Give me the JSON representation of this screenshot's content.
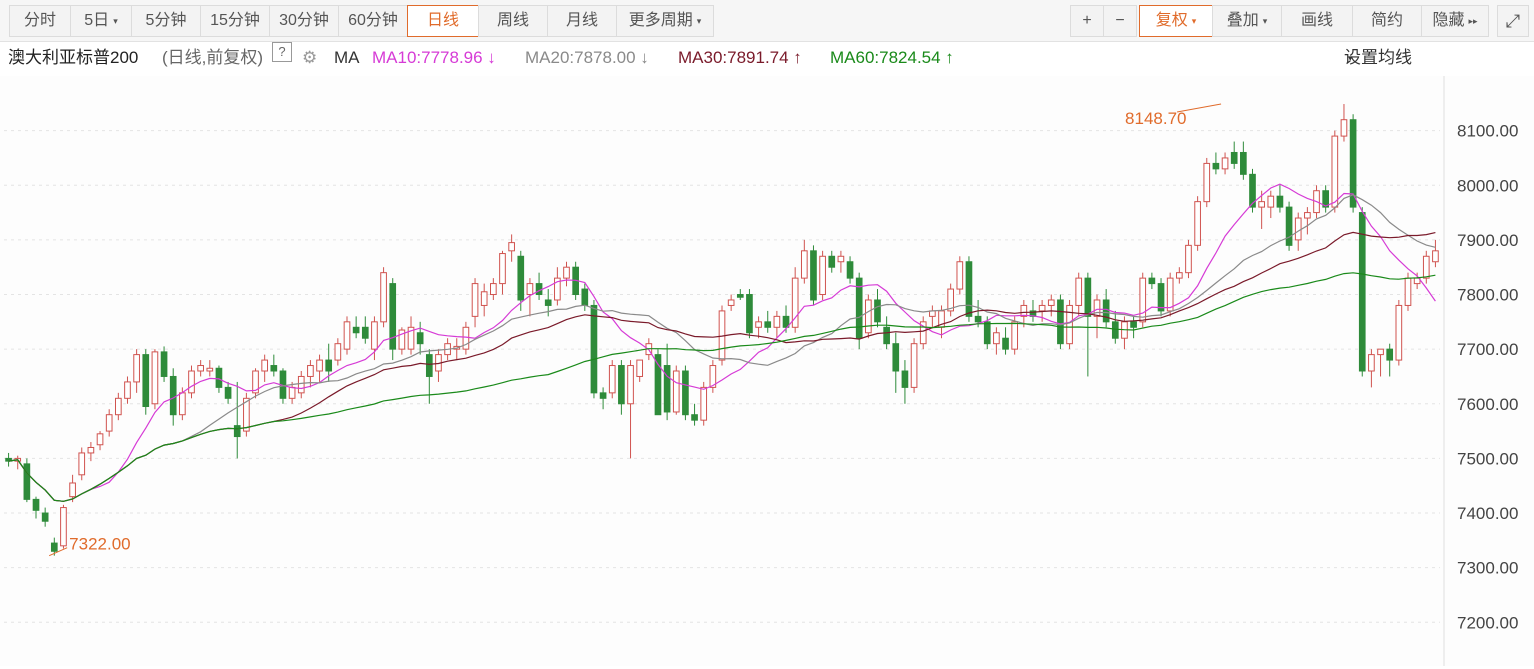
{
  "toolbar": {
    "left_buttons": [
      {
        "label": "分时",
        "dropdown": false,
        "active": false
      },
      {
        "label": "5日",
        "dropdown": true,
        "active": false
      },
      {
        "label": "5分钟",
        "dropdown": false,
        "active": false
      },
      {
        "label": "15分钟",
        "dropdown": false,
        "active": false
      },
      {
        "label": "30分钟",
        "dropdown": false,
        "active": false
      },
      {
        "label": "60分钟",
        "dropdown": false,
        "active": false
      },
      {
        "label": "日线",
        "dropdown": false,
        "active": true
      },
      {
        "label": "周线",
        "dropdown": false,
        "active": false
      },
      {
        "label": "月线",
        "dropdown": false,
        "active": false
      },
      {
        "label": "更多周期",
        "dropdown": true,
        "active": false
      }
    ],
    "zoom_in": "+",
    "zoom_out": "−",
    "right_buttons": [
      {
        "label": "复权",
        "dropdown": true,
        "accent": true
      },
      {
        "label": "叠加",
        "dropdown": true,
        "accent": false
      },
      {
        "label": "画线",
        "dropdown": false,
        "accent": false
      },
      {
        "label": "简约",
        "dropdown": false,
        "accent": false
      },
      {
        "label": "隐藏",
        "dropdown": false,
        "accent": false,
        "suffix": "▸▸"
      }
    ],
    "fullscreen_icon": "expand-icon"
  },
  "legend": {
    "title": "澳大利亚标普200",
    "subtitle": "(日线,前复权)",
    "help": "?",
    "ma_label": "MA",
    "ma": [
      {
        "text": "MA10:7778.96",
        "arrow": "↓",
        "color": "#d63bd6"
      },
      {
        "text": "MA20:7878.00",
        "arrow": "↓",
        "color": "#8a8a8a"
      },
      {
        "text": "MA30:7891.74",
        "arrow": "↑",
        "color": "#7a1a2a"
      },
      {
        "text": "MA60:7824.54",
        "arrow": "↑",
        "color": "#1a8a1a"
      }
    ],
    "settings": "设置均线"
  },
  "colors": {
    "up": "#d0534f",
    "down": "#2e8b3a",
    "annotation": "#e06b2b",
    "grid": "#e4e4e4",
    "axis_text": "#444"
  },
  "chart_data": {
    "type": "candlestick",
    "y_tick_labels": [
      "8100.00",
      "8000.00",
      "7900.00",
      "7800.00",
      "7700.00",
      "7600.00",
      "7500.00",
      "7400.00",
      "7300.00",
      "7200.00"
    ],
    "y_ticks": [
      8100,
      8000,
      7900,
      7800,
      7700,
      7600,
      7500,
      7400,
      7300,
      7200
    ],
    "ylim": [
      7120,
      8200
    ],
    "high_annotation": {
      "label": "8148.70",
      "value": 8148.7,
      "index": 133
    },
    "low_annotation": {
      "label": "7322.00",
      "value": 7322,
      "index": 4
    },
    "candles": [
      [
        7500,
        7510,
        7485,
        7495
      ],
      [
        7495,
        7505,
        7480,
        7500
      ],
      [
        7490,
        7500,
        7420,
        7425
      ],
      [
        7425,
        7430,
        7390,
        7405
      ],
      [
        7400,
        7410,
        7375,
        7385
      ],
      [
        7345,
        7355,
        7322,
        7330
      ],
      [
        7340,
        7415,
        7335,
        7410
      ],
      [
        7430,
        7470,
        7420,
        7455
      ],
      [
        7470,
        7520,
        7460,
        7510
      ],
      [
        7510,
        7530,
        7495,
        7520
      ],
      [
        7525,
        7550,
        7515,
        7545
      ],
      [
        7550,
        7590,
        7540,
        7580
      ],
      [
        7580,
        7620,
        7570,
        7610
      ],
      [
        7610,
        7650,
        7600,
        7640
      ],
      [
        7640,
        7700,
        7620,
        7690
      ],
      [
        7690,
        7700,
        7580,
        7595
      ],
      [
        7600,
        7700,
        7590,
        7695
      ],
      [
        7695,
        7705,
        7640,
        7650
      ],
      [
        7650,
        7665,
        7560,
        7580
      ],
      [
        7580,
        7630,
        7570,
        7620
      ],
      [
        7620,
        7670,
        7610,
        7660
      ],
      [
        7660,
        7680,
        7650,
        7670
      ],
      [
        7660,
        7680,
        7650,
        7665
      ],
      [
        7665,
        7670,
        7620,
        7630
      ],
      [
        7630,
        7640,
        7600,
        7610
      ],
      [
        7560,
        7640,
        7500,
        7540
      ],
      [
        7550,
        7620,
        7540,
        7610
      ],
      [
        7620,
        7665,
        7610,
        7660
      ],
      [
        7660,
        7690,
        7640,
        7680
      ],
      [
        7670,
        7690,
        7650,
        7660
      ],
      [
        7660,
        7665,
        7600,
        7610
      ],
      [
        7610,
        7640,
        7600,
        7630
      ],
      [
        7620,
        7660,
        7610,
        7650
      ],
      [
        7650,
        7680,
        7630,
        7670
      ],
      [
        7660,
        7690,
        7640,
        7680
      ],
      [
        7680,
        7710,
        7640,
        7660
      ],
      [
        7680,
        7720,
        7670,
        7710
      ],
      [
        7700,
        7760,
        7690,
        7750
      ],
      [
        7740,
        7760,
        7720,
        7730
      ],
      [
        7740,
        7760,
        7710,
        7720
      ],
      [
        7700,
        7760,
        7680,
        7750
      ],
      [
        7750,
        7850,
        7740,
        7840
      ],
      [
        7820,
        7830,
        7680,
        7700
      ],
      [
        7700,
        7740,
        7690,
        7735
      ],
      [
        7700,
        7760,
        7690,
        7740
      ],
      [
        7730,
        7750,
        7690,
        7710
      ],
      [
        7690,
        7700,
        7600,
        7650
      ],
      [
        7660,
        7700,
        7640,
        7690
      ],
      [
        7690,
        7720,
        7680,
        7710
      ],
      [
        7700,
        7720,
        7680,
        7705
      ],
      [
        7700,
        7750,
        7690,
        7740
      ],
      [
        7760,
        7830,
        7740,
        7820
      ],
      [
        7780,
        7820,
        7760,
        7805
      ],
      [
        7800,
        7830,
        7790,
        7820
      ],
      [
        7820,
        7880,
        7800,
        7875
      ],
      [
        7880,
        7910,
        7860,
        7895
      ],
      [
        7870,
        7880,
        7770,
        7790
      ],
      [
        7800,
        7830,
        7760,
        7820
      ],
      [
        7820,
        7840,
        7790,
        7800
      ],
      [
        7790,
        7810,
        7760,
        7780
      ],
      [
        7790,
        7850,
        7780,
        7830
      ],
      [
        7830,
        7860,
        7815,
        7850
      ],
      [
        7850,
        7860,
        7790,
        7800
      ],
      [
        7810,
        7820,
        7770,
        7780
      ],
      [
        7780,
        7790,
        7610,
        7620
      ],
      [
        7620,
        7630,
        7590,
        7610
      ],
      [
        7620,
        7680,
        7610,
        7670
      ],
      [
        7670,
        7680,
        7580,
        7600
      ],
      [
        7600,
        7680,
        7500,
        7670
      ],
      [
        7650,
        7680,
        7640,
        7680
      ],
      [
        7690,
        7720,
        7680,
        7710
      ],
      [
        7690,
        7700,
        7640,
        7580
      ],
      [
        7670,
        7710,
        7570,
        7585
      ],
      [
        7585,
        7670,
        7580,
        7660
      ],
      [
        7660,
        7670,
        7570,
        7580
      ],
      [
        7580,
        7600,
        7560,
        7570
      ],
      [
        7570,
        7640,
        7560,
        7630
      ],
      [
        7630,
        7680,
        7620,
        7670
      ],
      [
        7680,
        7780,
        7670,
        7770
      ],
      [
        7780,
        7800,
        7770,
        7790
      ],
      [
        7800,
        7810,
        7790,
        7795
      ],
      [
        7800,
        7810,
        7720,
        7730
      ],
      [
        7740,
        7760,
        7720,
        7750
      ],
      [
        7750,
        7770,
        7730,
        7740
      ],
      [
        7740,
        7770,
        7720,
        7760
      ],
      [
        7760,
        7780,
        7730,
        7740
      ],
      [
        7740,
        7850,
        7730,
        7830
      ],
      [
        7830,
        7900,
        7820,
        7880
      ],
      [
        7880,
        7890,
        7780,
        7790
      ],
      [
        7800,
        7880,
        7790,
        7870
      ],
      [
        7870,
        7880,
        7840,
        7850
      ],
      [
        7860,
        7880,
        7840,
        7870
      ],
      [
        7860,
        7870,
        7820,
        7830
      ],
      [
        7830,
        7840,
        7700,
        7720
      ],
      [
        7730,
        7800,
        7720,
        7790
      ],
      [
        7790,
        7810,
        7740,
        7750
      ],
      [
        7740,
        7760,
        7700,
        7710
      ],
      [
        7710,
        7730,
        7620,
        7660
      ],
      [
        7660,
        7680,
        7600,
        7630
      ],
      [
        7630,
        7720,
        7620,
        7710
      ],
      [
        7710,
        7760,
        7700,
        7750
      ],
      [
        7760,
        7780,
        7740,
        7770
      ],
      [
        7740,
        7780,
        7720,
        7770
      ],
      [
        7770,
        7820,
        7760,
        7810
      ],
      [
        7810,
        7870,
        7800,
        7860
      ],
      [
        7860,
        7870,
        7750,
        7760
      ],
      [
        7760,
        7790,
        7740,
        7750
      ],
      [
        7750,
        7760,
        7700,
        7710
      ],
      [
        7710,
        7740,
        7690,
        7730
      ],
      [
        7720,
        7740,
        7690,
        7700
      ],
      [
        7700,
        7760,
        7690,
        7750
      ],
      [
        7760,
        7790,
        7740,
        7780
      ],
      [
        7770,
        7790,
        7750,
        7760
      ],
      [
        7770,
        7790,
        7750,
        7780
      ],
      [
        7780,
        7800,
        7760,
        7790
      ],
      [
        7790,
        7800,
        7700,
        7710
      ],
      [
        7710,
        7790,
        7700,
        7780
      ],
      [
        7780,
        7840,
        7760,
        7830
      ],
      [
        7830,
        7840,
        7650,
        7760
      ],
      [
        7760,
        7800,
        7720,
        7790
      ],
      [
        7790,
        7810,
        7740,
        7750
      ],
      [
        7750,
        7770,
        7710,
        7720
      ],
      [
        7720,
        7760,
        7700,
        7750
      ],
      [
        7750,
        7760,
        7720,
        7740
      ],
      [
        7750,
        7840,
        7740,
        7830
      ],
      [
        7830,
        7840,
        7810,
        7820
      ],
      [
        7820,
        7830,
        7760,
        7770
      ],
      [
        7770,
        7840,
        7760,
        7830
      ],
      [
        7830,
        7850,
        7820,
        7840
      ],
      [
        7840,
        7900,
        7830,
        7890
      ],
      [
        7890,
        7980,
        7880,
        7970
      ],
      [
        7970,
        8050,
        7960,
        8040
      ],
      [
        8040,
        8060,
        8020,
        8030
      ],
      [
        8030,
        8060,
        8020,
        8050
      ],
      [
        8060,
        8080,
        8030,
        8040
      ],
      [
        8060,
        8080,
        8010,
        8020
      ],
      [
        8020,
        8030,
        7950,
        7960
      ],
      [
        7960,
        7990,
        7920,
        7970
      ],
      [
        7960,
        7990,
        7940,
        7980
      ],
      [
        7980,
        8000,
        7950,
        7960
      ],
      [
        7960,
        7970,
        7880,
        7890
      ],
      [
        7900,
        7950,
        7880,
        7940
      ],
      [
        7940,
        7960,
        7910,
        7950
      ],
      [
        7950,
        8000,
        7940,
        7990
      ],
      [
        7990,
        8000,
        7950,
        7960
      ],
      [
        7960,
        8100,
        7950,
        8090
      ],
      [
        8090,
        8148.7,
        8080,
        8120
      ],
      [
        8120,
        8130,
        7950,
        7960
      ],
      [
        7950,
        7960,
        7650,
        7660
      ],
      [
        7660,
        7700,
        7630,
        7690
      ],
      [
        7690,
        7700,
        7650,
        7700
      ],
      [
        7700,
        7710,
        7650,
        7680
      ],
      [
        7680,
        7790,
        7670,
        7780
      ],
      [
        7780,
        7840,
        7770,
        7830
      ],
      [
        7820,
        7840,
        7810,
        7830
      ],
      [
        7830,
        7880,
        7820,
        7870
      ],
      [
        7860,
        7900,
        7850,
        7880
      ]
    ]
  }
}
